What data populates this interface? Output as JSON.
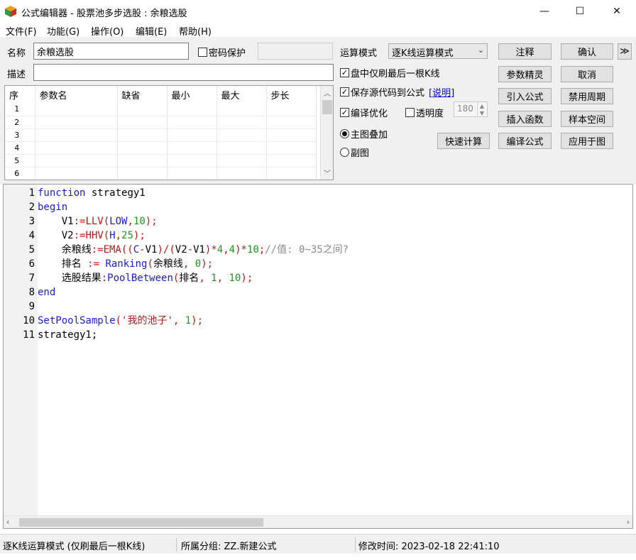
{
  "window": {
    "title": "公式编辑器 - 股票池多步选股 : 余粮选股",
    "min": "—",
    "max": "☐",
    "close": "✕"
  },
  "menu": [
    "文件(F)",
    "功能(G)",
    "操作(O)",
    "编辑(E)",
    "帮助(H)"
  ],
  "form": {
    "name_label": "名称",
    "name_value": "余粮选股",
    "password_label": "密码保护",
    "desc_label": "描述",
    "desc_value": "",
    "mode_label": "运算模式",
    "mode_value": "逐K线运算模式",
    "opt_refresh_last": "盘中仅刷最后一根K线",
    "opt_save_source": "保存源代码到公式",
    "explain_link": "[说明]",
    "opt_compile_opt": "编译优化",
    "opt_transparency": "透明度",
    "transparency_value": "180",
    "radio_main": "主图叠加",
    "radio_sub": "副图"
  },
  "buttons": {
    "quick_calc": "快速计算",
    "comment": "注释",
    "confirm": "确认",
    "more": "≫",
    "param_wizard": "参数精灵",
    "cancel": "取消",
    "import_formula": "引入公式",
    "disable_period": "禁用周期",
    "insert_function": "插入函数",
    "sample_space": "样本空间",
    "compile_formula": "编译公式",
    "apply_to_chart": "应用于图"
  },
  "params_table": {
    "headers": [
      "序",
      "参数名",
      "缺省",
      "最小",
      "最大",
      "步长"
    ],
    "rows": [
      "1",
      "2",
      "3",
      "4",
      "5",
      "6"
    ]
  },
  "code_lines": [
    {
      "n": "1",
      "tokens": [
        {
          "t": "function",
          "c": "kw"
        },
        {
          "t": " strategy1",
          "c": "txt"
        }
      ]
    },
    {
      "n": "2",
      "tokens": [
        {
          "t": "begin",
          "c": "kw"
        }
      ]
    },
    {
      "n": "3",
      "tokens": [
        {
          "t": "    V1",
          "c": "txt"
        },
        {
          "t": ":=",
          "c": "op"
        },
        {
          "t": "LLV",
          "c": "fnr"
        },
        {
          "t": "(",
          "c": "op"
        },
        {
          "t": "LOW",
          "c": "fn"
        },
        {
          "t": ",",
          "c": "op"
        },
        {
          "t": "10",
          "c": "num"
        },
        {
          "t": ");",
          "c": "op"
        }
      ]
    },
    {
      "n": "4",
      "tokens": [
        {
          "t": "    V2",
          "c": "txt"
        },
        {
          "t": ":=",
          "c": "op"
        },
        {
          "t": "HHV",
          "c": "fnr"
        },
        {
          "t": "(",
          "c": "op"
        },
        {
          "t": "H",
          "c": "fn"
        },
        {
          "t": ",",
          "c": "op"
        },
        {
          "t": "25",
          "c": "num"
        },
        {
          "t": ");",
          "c": "op"
        }
      ]
    },
    {
      "n": "5",
      "tokens": [
        {
          "t": "    余粮线",
          "c": "txt"
        },
        {
          "t": ":=",
          "c": "op"
        },
        {
          "t": "EMA",
          "c": "fnr"
        },
        {
          "t": "((",
          "c": "op"
        },
        {
          "t": "C",
          "c": "fn"
        },
        {
          "t": "-",
          "c": "op"
        },
        {
          "t": "V1",
          "c": "txt"
        },
        {
          "t": ")/(",
          "c": "op"
        },
        {
          "t": "V2",
          "c": "txt"
        },
        {
          "t": "-",
          "c": "op"
        },
        {
          "t": "V1",
          "c": "txt"
        },
        {
          "t": ")*",
          "c": "op"
        },
        {
          "t": "4",
          "c": "num"
        },
        {
          "t": ",",
          "c": "op"
        },
        {
          "t": "4",
          "c": "num"
        },
        {
          "t": ")*",
          "c": "op"
        },
        {
          "t": "10",
          "c": "num"
        },
        {
          "t": ";",
          "c": "op"
        },
        {
          "t": "//值: 0~35之间?",
          "c": "cm"
        }
      ]
    },
    {
      "n": "6",
      "tokens": [
        {
          "t": "    排名 ",
          "c": "txt"
        },
        {
          "t": ":=",
          "c": "op"
        },
        {
          "t": " Ranking",
          "c": "fn"
        },
        {
          "t": "(",
          "c": "op"
        },
        {
          "t": "余粮线",
          "c": "txt"
        },
        {
          "t": ", ",
          "c": "op"
        },
        {
          "t": "0",
          "c": "num"
        },
        {
          "t": ");",
          "c": "op"
        }
      ]
    },
    {
      "n": "7",
      "tokens": [
        {
          "t": "    选股结果",
          "c": "txt"
        },
        {
          "t": ":",
          "c": "op"
        },
        {
          "t": "PoolBetween",
          "c": "fn"
        },
        {
          "t": "(",
          "c": "op"
        },
        {
          "t": "排名",
          "c": "txt"
        },
        {
          "t": ", ",
          "c": "op"
        },
        {
          "t": "1",
          "c": "num"
        },
        {
          "t": ", ",
          "c": "op"
        },
        {
          "t": "10",
          "c": "num"
        },
        {
          "t": ");",
          "c": "op"
        }
      ]
    },
    {
      "n": "8",
      "tokens": [
        {
          "t": "end",
          "c": "kw"
        }
      ]
    },
    {
      "n": "9",
      "tokens": []
    },
    {
      "n": "10",
      "tokens": [
        {
          "t": "SetPoolSample",
          "c": "fn"
        },
        {
          "t": "(",
          "c": "op"
        },
        {
          "t": "'我的池子'",
          "c": "str"
        },
        {
          "t": ", ",
          "c": "op"
        },
        {
          "t": "1",
          "c": "num"
        },
        {
          "t": ");",
          "c": "op"
        }
      ]
    },
    {
      "n": "11",
      "tokens": [
        {
          "t": "strategy1;",
          "c": "txt"
        }
      ]
    }
  ],
  "status": {
    "mode": "逐K线运算模式 (仅刷最后一根K线)",
    "group": "所属分组: ZZ.新建公式",
    "modified": "修改时间: 2023-02-18 22:41:10"
  },
  "icons": {
    "app": "app-cube-icon"
  },
  "colors": {
    "keyword": "#1a1ae6",
    "operator": "#d01010",
    "number": "#1c9a1c",
    "comment": "#8a8a8a",
    "string": "#b41818"
  }
}
